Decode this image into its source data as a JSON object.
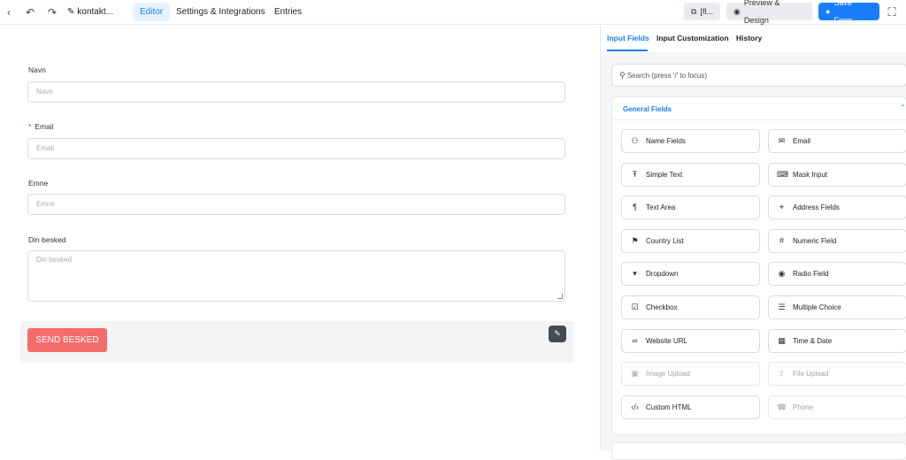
{
  "topbar": {
    "form_name": "kontakt...",
    "tabs": [
      "Editor",
      "Settings & Integrations",
      "Entries"
    ],
    "shortcode_label": "[fl...",
    "preview_label": "Preview & Design",
    "save_label": "Save Form"
  },
  "form": {
    "fields": [
      {
        "label": "Navn",
        "placeholder": "Navn",
        "required": false
      },
      {
        "label": "Email",
        "placeholder": "Email",
        "required": true
      },
      {
        "label": "Emne",
        "placeholder": "Emne",
        "required": false
      }
    ],
    "textarea": {
      "label": "Din besked",
      "placeholder": "Din besked"
    },
    "required_mark": "*",
    "submit_label": "SEND BESKED"
  },
  "panel": {
    "tabs": [
      "Input Fields",
      "Input Customization",
      "History"
    ],
    "search_placeholder": "Search (press '/' to focus)",
    "section_title": "General Fields",
    "fields": [
      {
        "label": "Name Fields",
        "icon": "user-icon",
        "disabled": false
      },
      {
        "label": "Email",
        "icon": "envelope-icon",
        "disabled": false
      },
      {
        "label": "Simple Text",
        "icon": "text-cursor-icon",
        "disabled": false
      },
      {
        "label": "Mask Input",
        "icon": "keyboard-icon",
        "disabled": false
      },
      {
        "label": "Text Area",
        "icon": "paragraph-icon",
        "disabled": false
      },
      {
        "label": "Address Fields",
        "icon": "map-pin-icon",
        "disabled": false
      },
      {
        "label": "Country List",
        "icon": "flag-icon",
        "disabled": false
      },
      {
        "label": "Numeric Field",
        "icon": "hash-icon",
        "disabled": false
      },
      {
        "label": "Dropdown",
        "icon": "dropdown-icon",
        "disabled": false
      },
      {
        "label": "Radio Field",
        "icon": "radio-icon",
        "disabled": false
      },
      {
        "label": "Checkbox",
        "icon": "checkbox-icon",
        "disabled": false
      },
      {
        "label": "Multiple Choice",
        "icon": "list-icon",
        "disabled": false
      },
      {
        "label": "Website URL",
        "icon": "link-icon",
        "disabled": false
      },
      {
        "label": "Time & Date",
        "icon": "calendar-icon",
        "disabled": false
      },
      {
        "label": "Image Upload",
        "icon": "image-icon",
        "disabled": true
      },
      {
        "label": "File Upload",
        "icon": "upload-icon",
        "disabled": true
      },
      {
        "label": "Custom HTML",
        "icon": "code-icon",
        "disabled": false
      },
      {
        "label": "Phone",
        "icon": "phone-icon",
        "disabled": true
      }
    ]
  }
}
